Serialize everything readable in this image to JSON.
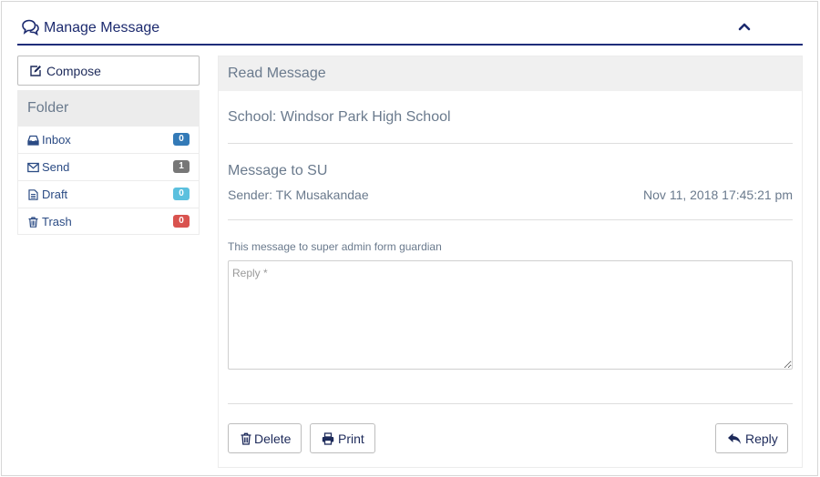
{
  "header": {
    "title": "Manage Message"
  },
  "left": {
    "compose_label": "Compose",
    "folder_title": "Folder",
    "folders": [
      {
        "label": "Inbox",
        "count": "0",
        "color": "#337ab7"
      },
      {
        "label": "Send",
        "count": "1",
        "color": "#777777"
      },
      {
        "label": "Draft",
        "count": "0",
        "color": "#5bc0de"
      },
      {
        "label": "Trash",
        "count": "0",
        "color": "#d9534f"
      }
    ]
  },
  "message": {
    "panel_title": "Read Message",
    "school": "School: Windsor Park High School",
    "subject": "Message to SU",
    "sender": "Sender: TK Musakandae",
    "date": "Nov 11, 2018 17:45:21 pm",
    "body": "This message to super admin form guardian",
    "reply_placeholder": "Reply *",
    "reply_value": ""
  },
  "actions": {
    "delete_label": "Delete",
    "print_label": "Print",
    "reply_label": "Reply"
  },
  "colors": {
    "accent": "#1f2d7a",
    "text_muted": "#6a7a8d"
  }
}
